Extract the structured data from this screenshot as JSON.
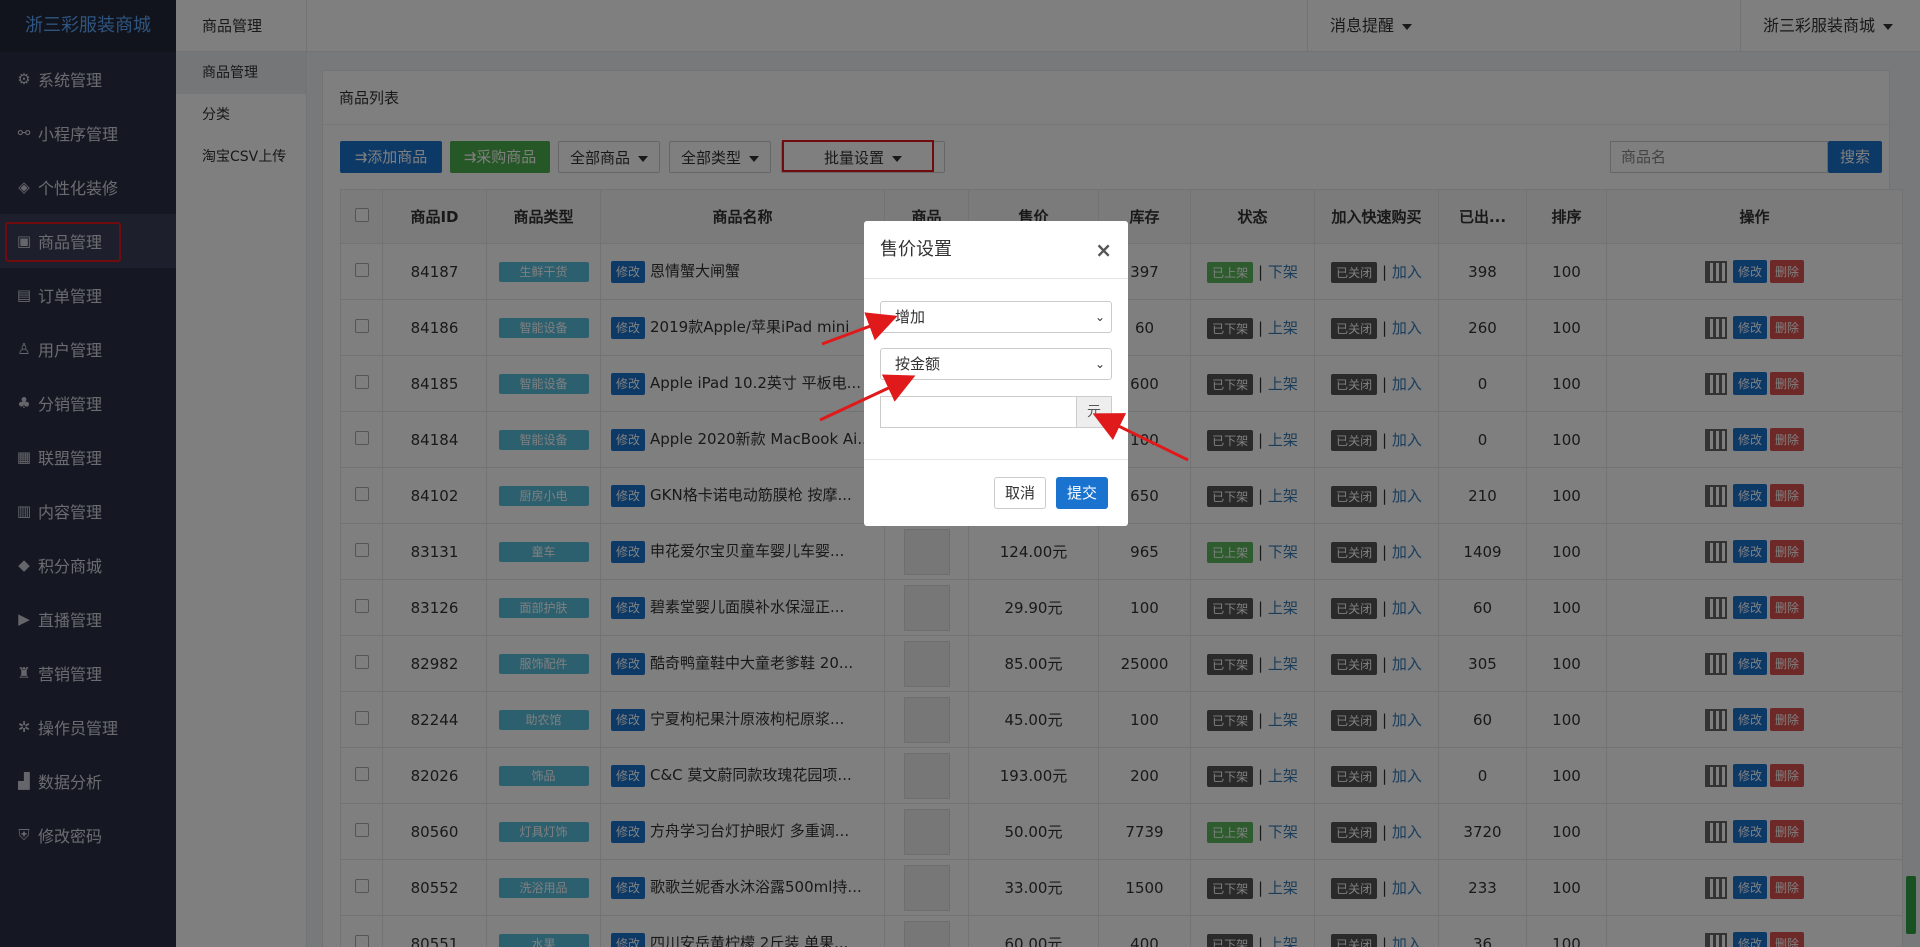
{
  "brand": "浙三彩服装商城",
  "sidebar": {
    "items": [
      {
        "icon": "gear-icon",
        "glyph": "⚙",
        "label": "系统管理"
      },
      {
        "icon": "link-icon",
        "glyph": "⚯",
        "label": "小程序管理"
      },
      {
        "icon": "palette-icon",
        "glyph": "◈",
        "label": "个性化装修"
      },
      {
        "icon": "bag-icon",
        "glyph": "▣",
        "label": "商品管理"
      },
      {
        "icon": "order-icon",
        "glyph": "▤",
        "label": "订单管理"
      },
      {
        "icon": "user-icon",
        "glyph": "♙",
        "label": "用户管理"
      },
      {
        "icon": "sitemap-icon",
        "glyph": "♣",
        "label": "分销管理"
      },
      {
        "icon": "store-icon",
        "glyph": "▦",
        "label": "联盟管理"
      },
      {
        "icon": "content-icon",
        "glyph": "▥",
        "label": "内容管理"
      },
      {
        "icon": "cube-icon",
        "glyph": "◆",
        "label": "积分商城"
      },
      {
        "icon": "play-icon",
        "glyph": "▶",
        "label": "直播管理"
      },
      {
        "icon": "marketing-icon",
        "glyph": "♜",
        "label": "营销管理"
      },
      {
        "icon": "operator-icon",
        "glyph": "✲",
        "label": "操作员管理"
      },
      {
        "icon": "chart-icon",
        "glyph": "▟",
        "label": "数据分析"
      },
      {
        "icon": "shield-icon",
        "glyph": "⛨",
        "label": "修改密码"
      }
    ]
  },
  "subnav": {
    "title": "商品管理",
    "items": [
      "商品管理",
      "分类",
      "淘宝CSV上传"
    ]
  },
  "header": {
    "messages": "消息提醒",
    "account": "浙三彩服装商城"
  },
  "panel": {
    "title": "商品列表",
    "add_product": "添加商品",
    "purchase_product": "采购商品",
    "all_products": "全部商品",
    "all_types": "全部类型",
    "batch_settings": "批量设置",
    "search_placeholder": "商品名",
    "search_button": "搜索"
  },
  "table": {
    "columns": [
      "商品ID",
      "商品类型",
      "商品名称",
      "商品",
      "售价",
      "库存",
      "状态",
      "加入快速购买",
      "已出...",
      "排序",
      "操作"
    ],
    "edit_tag": "修改",
    "status_sep": "|",
    "closed": "已关闭",
    "join": "加入",
    "op_edit": "修改",
    "op_delete": "删除",
    "rows": [
      {
        "id": "84187",
        "type": "生鲜干货",
        "name": "恩情蟹大闸蟹",
        "price": "",
        "stock": "397",
        "status": "已上架",
        "status_action": "下架",
        "sold": "398",
        "sort": "100"
      },
      {
        "id": "84186",
        "type": "智能设备",
        "name": "2019款Apple/苹果iPad mini",
        "price": "",
        "stock": "60",
        "status": "已下架",
        "status_action": "上架",
        "sold": "260",
        "sort": "100"
      },
      {
        "id": "84185",
        "type": "智能设备",
        "name": "Apple iPad 10.2英寸 平板电...",
        "price": "",
        "stock": "600",
        "status": "已下架",
        "status_action": "上架",
        "sold": "0",
        "sort": "100"
      },
      {
        "id": "84184",
        "type": "智能设备",
        "name": "Apple 2020新款 MacBook Ai...",
        "price": "",
        "stock": "100",
        "status": "已下架",
        "status_action": "上架",
        "sold": "0",
        "sort": "100"
      },
      {
        "id": "84102",
        "type": "厨房小电",
        "name": "GKN格卡诺电动筋膜枪 按摩...",
        "price": "",
        "stock": "650",
        "status": "已下架",
        "status_action": "上架",
        "sold": "210",
        "sort": "100"
      },
      {
        "id": "83131",
        "type": "童车",
        "name": "申花爱尔宝贝童车婴儿车婴...",
        "price": "124.00元",
        "stock": "965",
        "status": "已上架",
        "status_action": "下架",
        "sold": "1409",
        "sort": "100"
      },
      {
        "id": "83126",
        "type": "面部护肤",
        "name": "碧素堂婴儿面膜补水保湿正...",
        "price": "29.90元",
        "stock": "100",
        "status": "已下架",
        "status_action": "上架",
        "sold": "60",
        "sort": "100"
      },
      {
        "id": "82982",
        "type": "服饰配件",
        "name": "酷奇鸭童鞋中大童老爹鞋 20...",
        "price": "85.00元",
        "stock": "25000",
        "status": "已下架",
        "status_action": "上架",
        "sold": "305",
        "sort": "100"
      },
      {
        "id": "82244",
        "type": "助农馆",
        "name": "宁夏枸杞果汁原液枸杞原浆...",
        "price": "45.00元",
        "stock": "100",
        "status": "已下架",
        "status_action": "上架",
        "sold": "60",
        "sort": "100"
      },
      {
        "id": "82026",
        "type": "饰品",
        "name": "C&C 莫文蔚同款玫瑰花园项...",
        "price": "193.00元",
        "stock": "200",
        "status": "已下架",
        "status_action": "上架",
        "sold": "0",
        "sort": "100"
      },
      {
        "id": "80560",
        "type": "灯具灯饰",
        "name": "方舟学习台灯护眼灯 多重调...",
        "price": "50.00元",
        "stock": "7739",
        "status": "已上架",
        "status_action": "下架",
        "sold": "3720",
        "sort": "100"
      },
      {
        "id": "80552",
        "type": "洗浴用品",
        "name": "歌歌兰妮香水沐浴露500ml持...",
        "price": "33.00元",
        "stock": "1500",
        "status": "已下架",
        "status_action": "上架",
        "sold": "233",
        "sort": "100"
      },
      {
        "id": "80551",
        "type": "水果",
        "name": "四川安岳黄柠檬 2斤装 单果...",
        "price": "60.00元",
        "stock": "400",
        "status": "已下架",
        "status_action": "上架",
        "sold": "36",
        "sort": "100"
      }
    ]
  },
  "modal": {
    "title": "售价设置",
    "close": "×",
    "mode_select": "增加",
    "method_select": "按金额",
    "unit": "元",
    "cancel": "取消",
    "submit": "提交"
  },
  "colors": {
    "sidebar_bg": "#2b3046",
    "primary_blue": "#1a73cf",
    "green": "#4cae4c",
    "highlight_red": "#e0191b"
  }
}
